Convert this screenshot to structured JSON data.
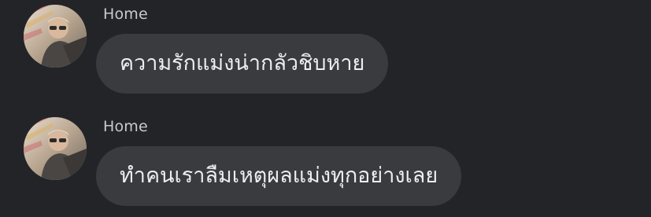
{
  "colors": {
    "background": "#232428",
    "bubble": "#3a3b3f",
    "sender_text": "#c9cacc",
    "message_text": "#ecedef"
  },
  "messages": [
    {
      "sender": "Home",
      "avatar_icon": "user-avatar",
      "text": "ความรักแม่งน่ากลัวชิบหาย"
    },
    {
      "sender": "Home",
      "avatar_icon": "user-avatar",
      "text": "ทำคนเราลืมเหตุผลแม่งทุกอย่างเลย"
    }
  ]
}
